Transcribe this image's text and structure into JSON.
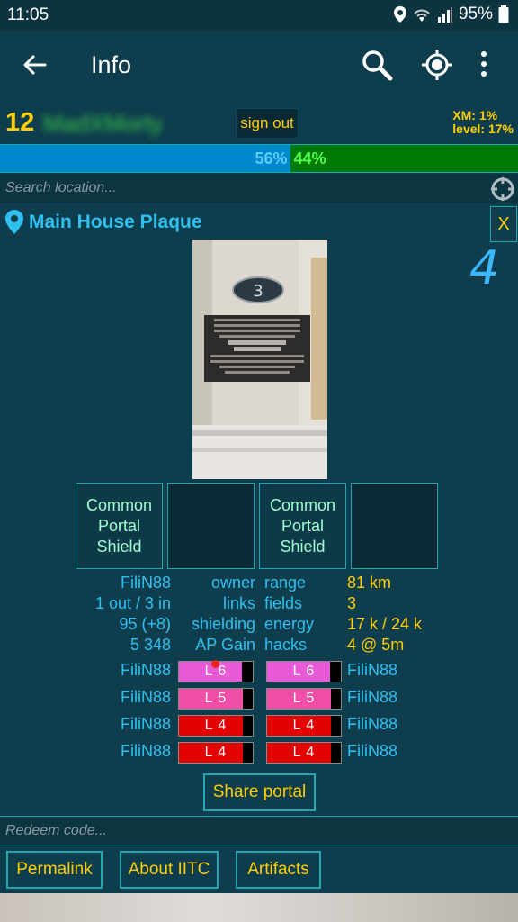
{
  "status_bar": {
    "time": "11:05",
    "battery": "95%"
  },
  "app_bar": {
    "title": "Info"
  },
  "player": {
    "level": "12",
    "name": "MadXMorty",
    "sign_out": "sign out",
    "xm": "XM: 1%",
    "level_progress": "level: 17%"
  },
  "team_bar": {
    "resistance": "56%",
    "enlightened": "44%",
    "resistance_fraction": 0.56,
    "enlightened_fraction": 0.44
  },
  "search": {
    "placeholder": "Search location..."
  },
  "portal": {
    "name": "Main House Plaque",
    "close_label": "X",
    "level": "4",
    "plaque_number": "3",
    "mods": [
      "Common\nPortal\nShield",
      "",
      "Common\nPortal\nShield",
      ""
    ],
    "details": [
      {
        "left_value": "FiliN88",
        "left_label": "owner",
        "right_label": "range",
        "right_value": "81 km"
      },
      {
        "left_value": "1 out / 3 in",
        "left_label": "links",
        "right_label": "fields",
        "right_value": "3"
      },
      {
        "left_value": "95 (+8)",
        "left_label": "shielding",
        "right_label": "energy",
        "right_value": "17 k / 24 k"
      },
      {
        "left_value": "5 348",
        "left_label": "AP Gain",
        "right_label": "hacks",
        "right_value": "4 @ 5m"
      }
    ],
    "resonators": [
      {
        "left_owner": "FiliN88",
        "left_level": "L 6",
        "left_fill": 0.85,
        "right_level": "L 6",
        "right_fill": 0.85,
        "right_owner": "FiliN88"
      },
      {
        "left_owner": "FiliN88",
        "left_level": "L 5",
        "left_fill": 0.87,
        "right_level": "L 5",
        "right_fill": 0.87,
        "right_owner": "FiliN88"
      },
      {
        "left_owner": "FiliN88",
        "left_level": "L 4",
        "left_fill": 0.86,
        "right_level": "L 4",
        "right_fill": 0.86,
        "right_owner": "FiliN88"
      },
      {
        "left_owner": "FiliN88",
        "left_level": "L 4",
        "left_fill": 0.86,
        "right_level": "L 4",
        "right_fill": 0.86,
        "right_owner": "FiliN88"
      }
    ],
    "share_label": "Share portal"
  },
  "redeem": {
    "placeholder": "Redeem code..."
  },
  "toolbox": {
    "permalink": "Permalink",
    "about": "About IITC",
    "artifacts": "Artifacts"
  },
  "colors": {
    "accent": "#ffce00",
    "teal_border": "#20a8b1",
    "resistance": "#0088cc",
    "enlightened": "#007a00",
    "l6": "#e85ad8",
    "l5": "#f04fa8",
    "l4": "#e20000"
  }
}
